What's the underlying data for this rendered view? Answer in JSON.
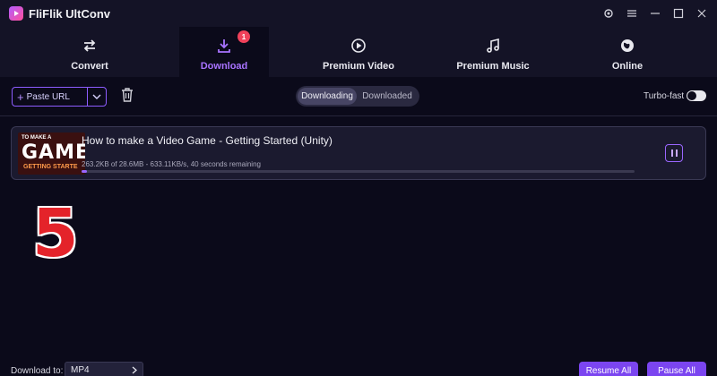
{
  "app": {
    "title": "FliFlik UltConv"
  },
  "colors": {
    "accent": "#9a66ff",
    "badge": "#f0415a",
    "background": "#0b0a1a",
    "number_overlay": "#e4232a"
  },
  "nav": {
    "tabs": [
      {
        "label": "Convert",
        "icon": "convert-arrows-icon",
        "active": false
      },
      {
        "label": "Download",
        "icon": "download-icon",
        "active": true,
        "badge": "1"
      },
      {
        "label": "Premium Video",
        "icon": "play-circle-icon",
        "active": false
      },
      {
        "label": "Premium Music",
        "icon": "music-note-icon",
        "active": false
      },
      {
        "label": "Online",
        "icon": "globe-icon",
        "active": false
      }
    ]
  },
  "toolbar": {
    "paste_label": "Paste URL",
    "segments": {
      "downloading": "Downloading",
      "downloaded": "Downloaded",
      "selected": "Downloading"
    },
    "turbo_label": "Turbo-fast",
    "turbo_on": false
  },
  "downloads": [
    {
      "title": "How to make a Video Game - Getting Started (Unity)",
      "thumb_line1": "TO MAKE A",
      "thumb_line2": "GAME",
      "thumb_line3": "GETTING STARTE",
      "status": "263.2KB of 28.6MB  -  633.11KB/s, 40 seconds remaining",
      "progress_pct": 0.9
    }
  ],
  "overlay_number": "5",
  "footer": {
    "download_to_label": "Download to:",
    "format": "MP4",
    "resume_label": "Resume All",
    "pause_label": "Pause All"
  }
}
